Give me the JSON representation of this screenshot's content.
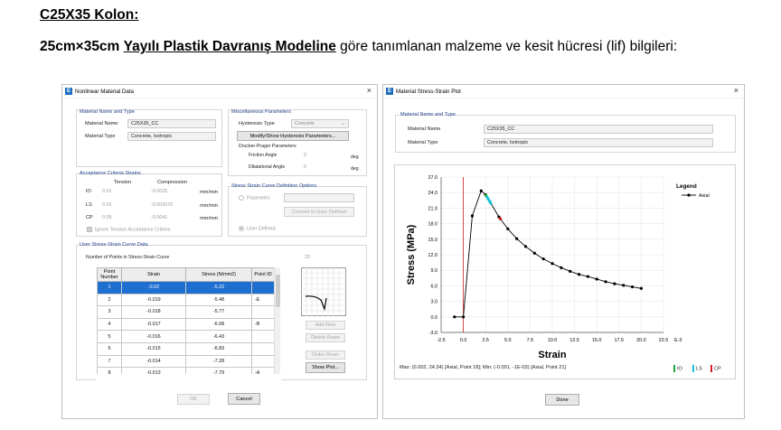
{
  "document": {
    "title": "C25X35 Kolon:",
    "para_bold1": "25cm×35cm",
    "para_bold2": "Yayılı Plastik Davranış Modeline",
    "para_rest": " göre tanımlanan malzeme ve kesit hücresi (lif) bilgileri:"
  },
  "left_window": {
    "icon": "E",
    "title": "Nonlinear Material Data",
    "close": "×",
    "mat_group": "Material Name and Type",
    "mat_name_label": "Material Name",
    "mat_name_value": "C25X35_CC",
    "mat_type_label": "Material Type",
    "mat_type_value": "Concrete, Isotropic",
    "misc_group": "Miscellaneous Parameters",
    "hyst_label": "Hysteresis Type",
    "hyst_value": "Concrete",
    "modify_btn": "Modify/Show Hysteresis Parameters...",
    "dp_label": "Drucker-Prager Parameters",
    "friction_label": "Friction Angle",
    "friction_value": "0",
    "dilat_label": "Dilatational Angle",
    "dilat_value": "0",
    "unit_deg": "deg",
    "acc_group": "Acceptance Criteria Strains",
    "tension_hdr": "Tension",
    "compression_hdr": "Compression",
    "acc_rows": [
      {
        "code": "IO",
        "tension": "0.01",
        "compression": "-0.0025",
        "unit": "mm/mm"
      },
      {
        "code": "LS",
        "tension": "0.02",
        "compression": "-0.003075",
        "unit": "mm/mm"
      },
      {
        "code": "CP",
        "tension": "0.05",
        "compression": "-0.0041",
        "unit": "mm/mm"
      }
    ],
    "ignore_tension": "Ignore Tension Acceptance Criteria",
    "ssc_group": "Stress Strain Curve Definition Options",
    "parametric": "Parametric",
    "convert_btn": "Convert to User Defined",
    "user_defined": "User Defined",
    "user_group": "User Stress-Strain Curve Data",
    "num_points_label": "Number of Points in Stress-Strain Curve",
    "num_points_value": "22",
    "col_point": "Point Number",
    "col_strain": "Strain",
    "col_stress": "Stress (N/mm2)",
    "col_pid": "Point ID",
    "rows": [
      {
        "n": "1",
        "strain": "-0.02",
        "stress": "-5.22",
        "pid": ""
      },
      {
        "n": "2",
        "strain": "-0.019",
        "stress": "-5.48",
        "pid": "-E"
      },
      {
        "n": "3",
        "strain": "-0.018",
        "stress": "-5.77",
        "pid": ""
      },
      {
        "n": "4",
        "strain": "-0.017",
        "stress": "-6.08",
        "pid": "-B"
      },
      {
        "n": "5",
        "strain": "-0.016",
        "stress": "-6.43",
        "pid": ""
      },
      {
        "n": "6",
        "strain": "-0.015",
        "stress": "-6.83",
        "pid": ""
      },
      {
        "n": "7",
        "strain": "-0.014",
        "stress": "-7.28",
        "pid": ""
      },
      {
        "n": "8",
        "strain": "-0.013",
        "stress": "-7.79",
        "pid": "-A"
      }
    ],
    "add_row": "Add Row",
    "delete_rows": "Delete Rows",
    "order_rows": "Order Rows",
    "show_plot": "Show Plot...",
    "ok_btn": "OK",
    "cancel_btn": "Cancel"
  },
  "right_window": {
    "icon": "E",
    "title": "Material Stress-Strain Plot",
    "close": "×",
    "mat_group": "Material Name and Type",
    "mat_name_label": "Material Name",
    "mat_name_value": "C25X35_CC",
    "mat_type_label": "Material Type",
    "mat_type_value": "Concrete, Isotropic",
    "status_text": "Max: (0.002, 24.34)  [Axial, Point 18];  Min: (-0.001, -1E-03)  [Axial, Point 21]",
    "legend_io": "IO",
    "legend_ls": "LS",
    "legend_cp": "CP",
    "done_btn": "Done"
  },
  "chart_data": {
    "type": "line",
    "xlabel": "Strain",
    "ylabel": "Stress (MPa)",
    "x_unit_label": "E-3",
    "legend_title": "Legend",
    "xlim": [
      -2.5,
      22.5
    ],
    "ylim": [
      -3.0,
      27.0
    ],
    "xticks": [
      "-2.5",
      "0.0",
      "2.5",
      "5.0",
      "7.5",
      "10.0",
      "12.5",
      "15.0",
      "17.5",
      "20.0",
      "22.5"
    ],
    "yticks": [
      "-3.0",
      "0.0",
      "3.0",
      "6.0",
      "9.0",
      "12.0",
      "15.0",
      "18.0",
      "21.0",
      "24.0",
      "27.0"
    ],
    "series": [
      {
        "name": "Axial",
        "color": "#000000",
        "x": [
          -1.0,
          0.0,
          1.0,
          2.0,
          2.5,
          3.0,
          4.0,
          5.0,
          6.0,
          7.0,
          8.0,
          9.0,
          10.0,
          11.0,
          12.0,
          13.0,
          14.0,
          15.0,
          16.0,
          17.0,
          18.0,
          19.0,
          20.0
        ],
        "y": [
          0.0,
          0.0,
          19.5,
          24.34,
          23.6,
          22.2,
          19.3,
          17.0,
          15.1,
          13.6,
          12.3,
          11.2,
          10.3,
          9.5,
          8.8,
          8.2,
          7.8,
          7.3,
          6.8,
          6.4,
          6.1,
          5.8,
          5.5
        ]
      }
    ],
    "vline_x": 0.0,
    "vline_color": "#cc0000",
    "acceptance_segments": [
      {
        "name": "IO",
        "color": "#1aa83a",
        "x": [
          2.45,
          2.6
        ]
      },
      {
        "name": "LS",
        "color": "#16c4d8",
        "x": [
          2.6,
          3.15
        ]
      },
      {
        "name": "CP",
        "color": "#d62020",
        "x": [
          4.05,
          4.25
        ]
      }
    ]
  }
}
